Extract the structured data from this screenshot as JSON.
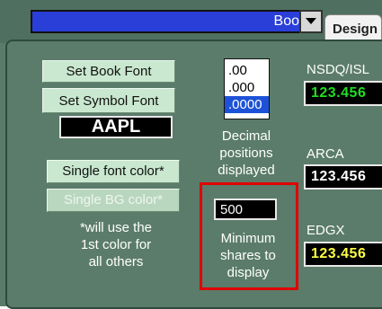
{
  "header": {
    "book_dropdown_value": "Books",
    "tab_design_label": "Design"
  },
  "left_panel": {
    "set_book_font_label": "Set Book Font",
    "set_symbol_font_label": "Set Symbol Font",
    "symbol_preview_text": "AAPL",
    "single_font_color_label": "Single font color*",
    "single_bg_color_label": "Single BG color*",
    "note_lines": [
      "*will use the",
      "1st color for",
      "all others"
    ]
  },
  "decimals": {
    "options": [
      ".00",
      ".000",
      ".0000"
    ],
    "selected_index": 2,
    "caption_lines": [
      "Decimal",
      "positions",
      "displayed"
    ]
  },
  "min_shares": {
    "value": "500",
    "caption_lines": [
      "Minimum",
      "shares to",
      "display"
    ],
    "highlight_color": "#e00000"
  },
  "exchanges": [
    {
      "label": "NSDQ/ISL",
      "quote": "123.456",
      "color": "#22dd22"
    },
    {
      "label": "ARCA",
      "quote": "123.456",
      "color": "#ffffff"
    },
    {
      "label": "EDGX",
      "quote": "123.456",
      "color": "#ffff44"
    }
  ],
  "colors": {
    "panel_bg": "#5b7c6a",
    "button_bg": "#c9e8cf",
    "combo_bg": "#2a3fd8",
    "list_selected": "#1d52d8"
  }
}
